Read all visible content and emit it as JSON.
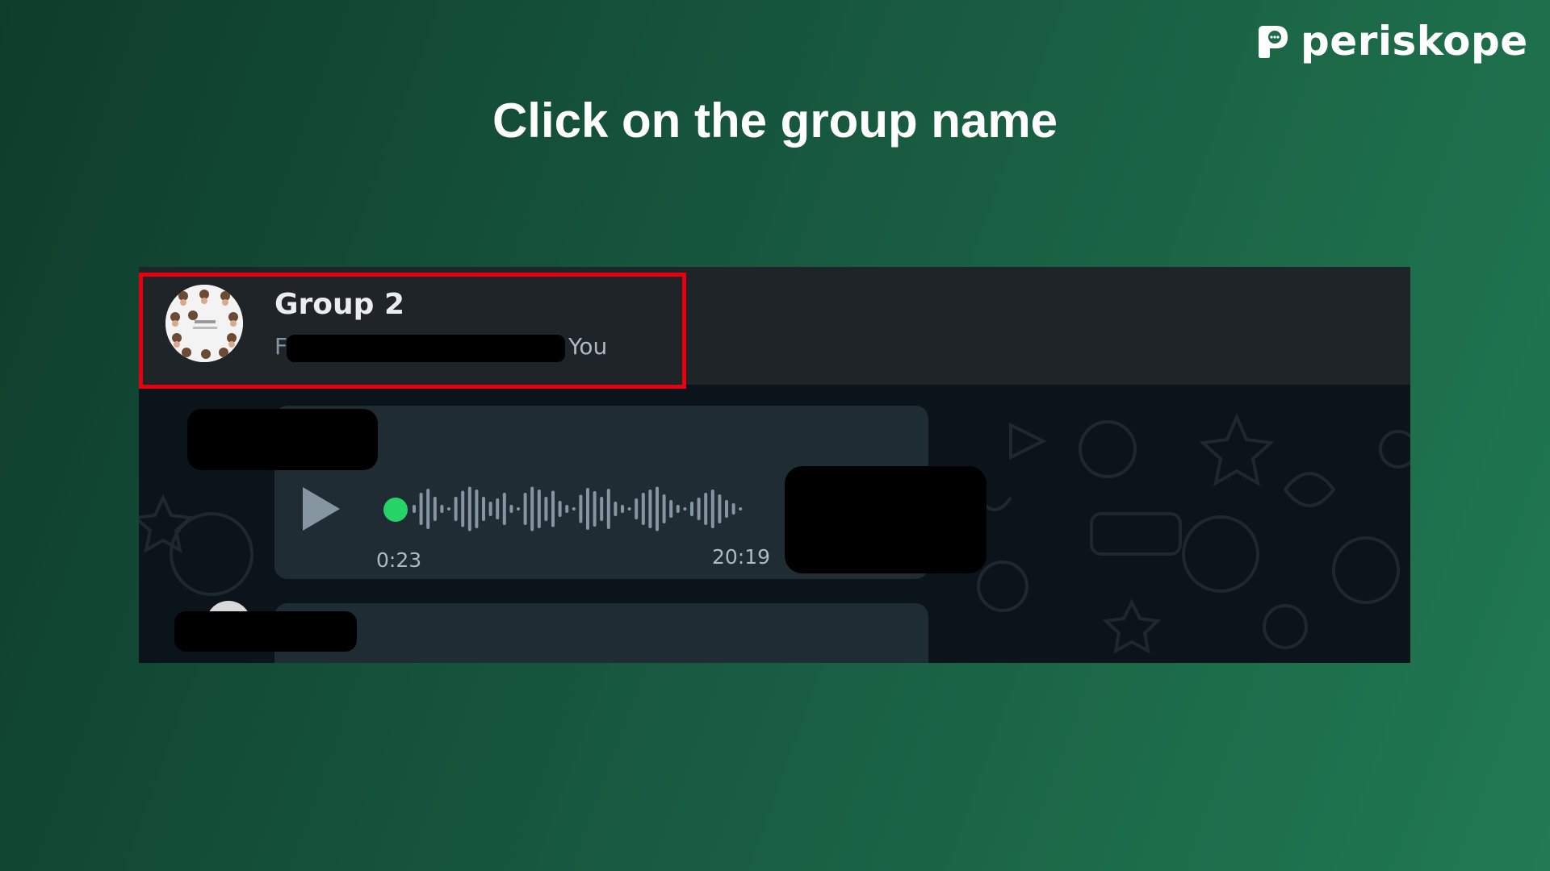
{
  "brand": {
    "name": "periskope",
    "icon": "periskope-logo-icon"
  },
  "slide": {
    "title": "Click on the group name"
  },
  "chat_header": {
    "group_name": "Group 2",
    "members_prefix": "F",
    "members_suffix": "You"
  },
  "voice_message": {
    "played_time": "0:23",
    "sent_time": "20:19",
    "icon": "play-icon",
    "dot_color": "#25d366"
  },
  "colors": {
    "highlight": "#e8000e",
    "header_bg": "#1f2429",
    "bubble_bg": "#1f2c33",
    "chat_bg": "#0b141a"
  }
}
